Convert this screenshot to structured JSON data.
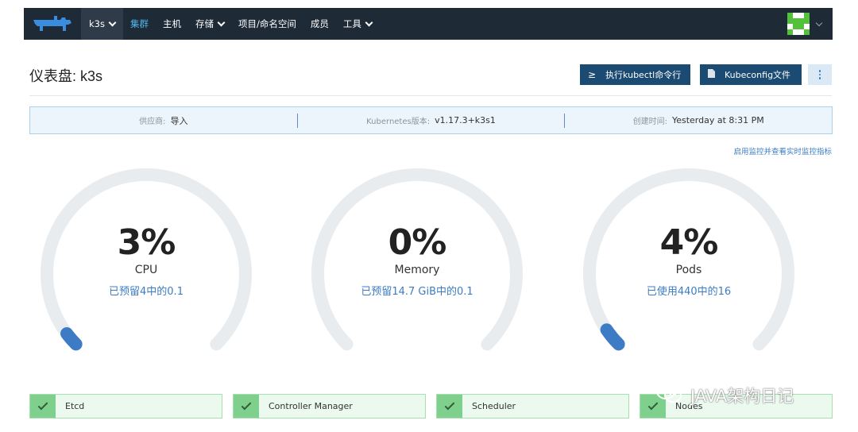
{
  "nav": {
    "cluster": "k3s",
    "items": [
      {
        "label": "集群",
        "active": true,
        "dropdown": false
      },
      {
        "label": "主机",
        "active": false,
        "dropdown": false
      },
      {
        "label": "存储",
        "active": false,
        "dropdown": true
      },
      {
        "label": "项目/命名空间",
        "active": false,
        "dropdown": false
      },
      {
        "label": "成员",
        "active": false,
        "dropdown": false
      },
      {
        "label": "工具",
        "active": false,
        "dropdown": true
      }
    ]
  },
  "header": {
    "title": "仪表盘: k3s",
    "kubectl_button": "执行kubectl命令行",
    "kubectl_icon": "≥",
    "kubeconfig_button": "Kubeconfig文件"
  },
  "info": {
    "provider_label": "供应商:",
    "provider_value": "导入",
    "k8s_label": "Kubernetes版本:",
    "k8s_value": "v1.17.3+k3s1",
    "created_label": "创建时间:",
    "created_value": "Yesterday at 8:31 PM"
  },
  "monitor_link": "启用监控并查看实时监控指标",
  "gauges": [
    {
      "value": "3%",
      "name": "CPU",
      "sub": "已预留4中的0.1",
      "percent": 3
    },
    {
      "value": "0%",
      "name": "Memory",
      "sub": "已预留14.7 GiB中的0.1",
      "percent": 0
    },
    {
      "value": "4%",
      "name": "Pods",
      "sub": "已使用440中的16",
      "percent": 4
    }
  ],
  "components": [
    {
      "name": "Etcd",
      "status": "ok"
    },
    {
      "name": "Controller Manager",
      "status": "ok"
    },
    {
      "name": "Scheduler",
      "status": "ok"
    },
    {
      "name": "Nodes",
      "status": "ok"
    }
  ],
  "watermark": "JAVA架构日记",
  "colors": {
    "nav_bg": "#1f2a37",
    "primary_button": "#1b4a72",
    "link": "#3d7cc4",
    "gauge_track": "#e8ecef",
    "gauge_fill": "#3d7cc4",
    "ok_green": "#7fd08d"
  }
}
